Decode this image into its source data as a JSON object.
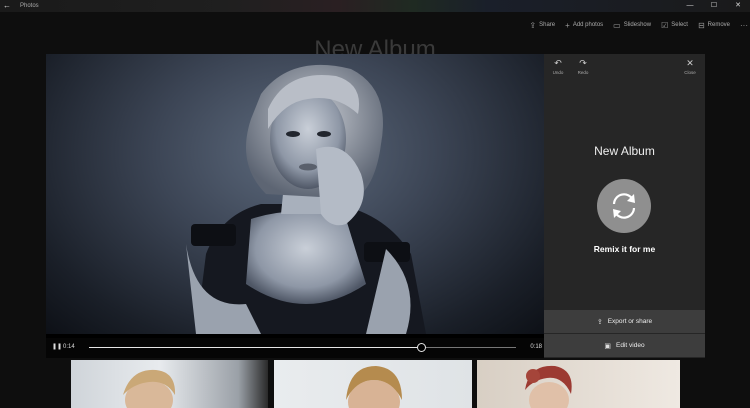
{
  "app": {
    "title": "Photos"
  },
  "window_controls": {
    "minimize": "—",
    "maximize": "☐",
    "close": "✕"
  },
  "toolbar": [
    {
      "icon": "share-icon",
      "glyph": "⇪",
      "label": "Share"
    },
    {
      "icon": "add-photos-icon",
      "glyph": "+",
      "label": "Add photos"
    },
    {
      "icon": "slideshow-icon",
      "glyph": "▭",
      "label": "Slideshow"
    },
    {
      "icon": "select-icon",
      "glyph": "☑",
      "label": "Select"
    },
    {
      "icon": "remove-icon",
      "glyph": "⊟",
      "label": "Remove"
    },
    {
      "icon": "more-icon",
      "glyph": "···",
      "label": ""
    }
  ],
  "album": {
    "title": "New Album"
  },
  "player": {
    "current_time": "0:14",
    "end_time": "0:18",
    "progress": 0.778
  },
  "panel": {
    "undo_label": "Undo",
    "redo_label": "Redo",
    "close_label": "Close",
    "title": "New Album",
    "remix_label": "Remix it for me",
    "export_label": "Export or share",
    "edit_label": "Edit video"
  }
}
